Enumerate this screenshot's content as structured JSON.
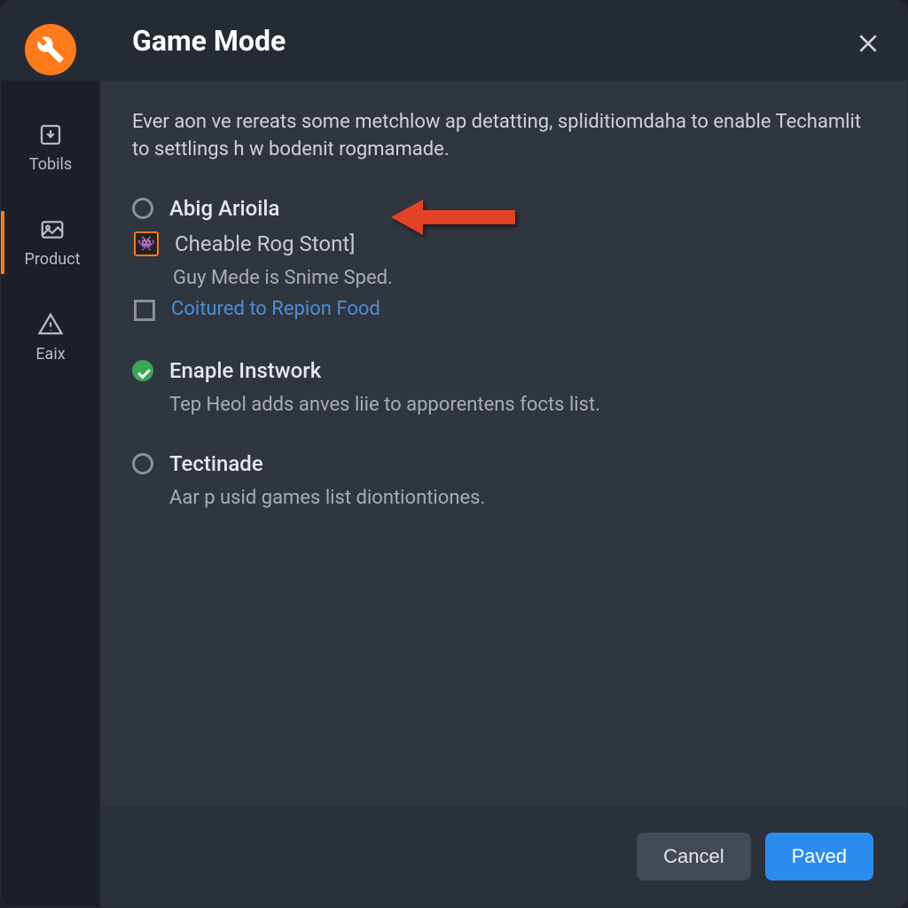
{
  "header": {
    "title": "Game Mode"
  },
  "sidebar": {
    "items": [
      {
        "label": "Tobils"
      },
      {
        "label": "Product"
      },
      {
        "label": "Eaix"
      }
    ]
  },
  "main": {
    "description": "Ever aon ve rereats some metchlow ap detatting, spliditiomdaha to enable Techamlit to settlings h w bodenit rogmamade.",
    "options": [
      {
        "label": "Abig Arioila",
        "sub1_label": "Cheable Rog Stont]",
        "sub1_desc": "Guy Mede is Snime Sped.",
        "sub2_label": "Coitured to Repion Food"
      },
      {
        "label": "Enaple Instwork",
        "desc": "Tep Heol adds anves liie to apporentens focts list."
      },
      {
        "label": "Tectinade",
        "desc": "Aar p usid games list diontiontiones."
      }
    ]
  },
  "footer": {
    "cancel": "Cancel",
    "save": "Paved"
  }
}
